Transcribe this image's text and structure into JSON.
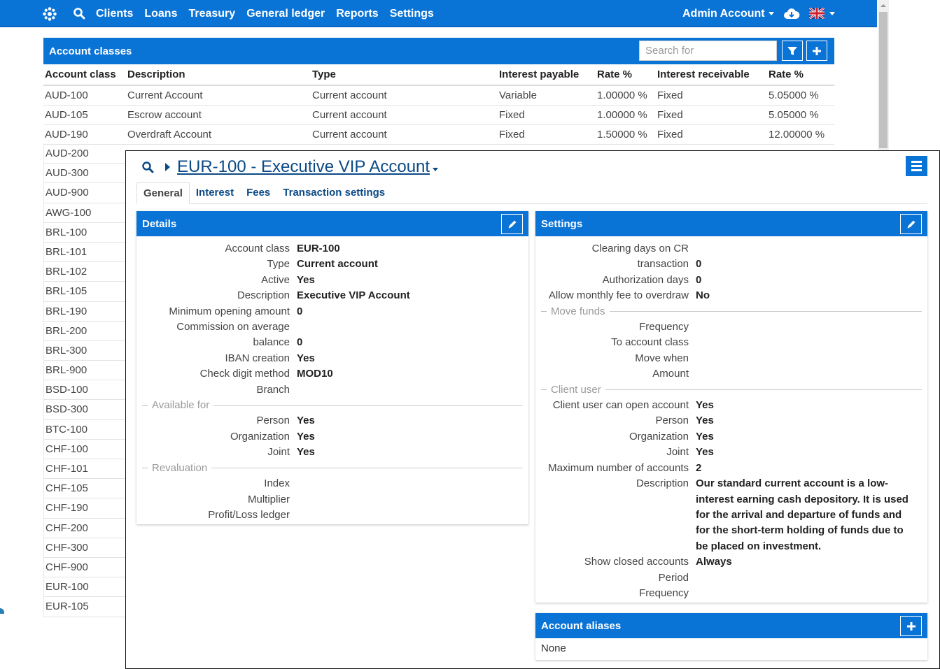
{
  "nav": {
    "items": [
      "Clients",
      "Loans",
      "Treasury",
      "General ledger",
      "Reports",
      "Settings"
    ],
    "user": "Admin Account",
    "icons": {
      "logo": "snowflake-logo-icon",
      "search": "search-icon",
      "cloud": "cloud-download-icon",
      "language": "uk-flag-icon"
    },
    "accent_color": "#0a73d6"
  },
  "list": {
    "title": "Account classes",
    "search_placeholder": "Search for",
    "columns": [
      "Account class",
      "Description",
      "Type",
      "Interest payable",
      "Rate %",
      "Interest receivable",
      "Rate %"
    ],
    "rows": [
      [
        "AUD-100",
        "Current Account",
        "Current account",
        "Variable",
        "1.00000 %",
        "Fixed",
        "5.05000 %"
      ],
      [
        "AUD-105",
        "Escrow account",
        "Current account",
        "Fixed",
        "1.00000 %",
        "Fixed",
        "5.05000 %"
      ],
      [
        "AUD-190",
        "Overdraft Account",
        "Current account",
        "Fixed",
        "1.50000 %",
        "Fixed",
        "12.00000 %"
      ]
    ],
    "more_classes": [
      "AUD-200",
      "AUD-300",
      "AUD-900",
      "AWG-100",
      "BRL-100",
      "BRL-101",
      "BRL-102",
      "BRL-105",
      "BRL-190",
      "BRL-200",
      "BRL-300",
      "BRL-900",
      "BSD-100",
      "BSD-300",
      "BTC-100",
      "CHF-100",
      "CHF-101",
      "CHF-105",
      "CHF-190",
      "CHF-200",
      "CHF-300",
      "CHF-900",
      "EUR-100",
      "EUR-105"
    ]
  },
  "detail": {
    "title": "EUR-100 - Executive VIP Account",
    "tabs": [
      "General",
      "Interest",
      "Fees",
      "Transaction settings"
    ],
    "active_tab": "General",
    "details": {
      "title": "Details",
      "fields": [
        {
          "label": "Account class",
          "value": "EUR-100"
        },
        {
          "label": "Type",
          "value": "Current account"
        },
        {
          "label": "Active",
          "value": "Yes"
        },
        {
          "label": "Description",
          "value": "Executive VIP Account"
        },
        {
          "label": "Minimum opening amount",
          "value": "0"
        },
        {
          "label": "Commission on average",
          "value": ""
        },
        {
          "label": "balance",
          "value": "0"
        },
        {
          "label": "IBAN creation",
          "value": "Yes"
        },
        {
          "label": "Check digit method",
          "value": "MOD10"
        },
        {
          "label": "Branch",
          "value": ""
        }
      ],
      "available_for": {
        "title": "Available for",
        "fields": [
          {
            "label": "Person",
            "value": "Yes"
          },
          {
            "label": "Organization",
            "value": "Yes"
          },
          {
            "label": "Joint",
            "value": "Yes"
          }
        ]
      },
      "revaluation": {
        "title": "Revaluation",
        "fields": [
          {
            "label": "Index",
            "value": ""
          },
          {
            "label": "Multiplier",
            "value": ""
          },
          {
            "label": "Profit/Loss ledger",
            "value": ""
          }
        ]
      }
    },
    "settings": {
      "title": "Settings",
      "fields": [
        {
          "label": "Clearing days on CR",
          "value": ""
        },
        {
          "label": "transaction",
          "value": "0"
        },
        {
          "label": "Authorization days",
          "value": "0"
        },
        {
          "label": "Allow monthly fee to overdraw",
          "value": "No"
        }
      ],
      "move_funds": {
        "title": "Move funds",
        "fields": [
          {
            "label": "Frequency",
            "value": ""
          },
          {
            "label": "To account class",
            "value": ""
          },
          {
            "label": "Move when",
            "value": ""
          },
          {
            "label": "Amount",
            "value": ""
          }
        ]
      },
      "client_user": {
        "title": "Client user",
        "fields": [
          {
            "label": "Client user can open account",
            "value": "Yes"
          },
          {
            "label": "Person",
            "value": "Yes"
          },
          {
            "label": "Organization",
            "value": "Yes"
          },
          {
            "label": "Joint",
            "value": "Yes"
          },
          {
            "label": "Maximum number of accounts",
            "value": "2"
          },
          {
            "label": "Description",
            "value": "Our standard current account is a low-interest earning cash depository. It is used for the arrival and departure of funds and for the short-term holding of funds due to be placed on investment."
          },
          {
            "label": "Show closed accounts",
            "value": "Always"
          },
          {
            "label": "Period",
            "value": ""
          },
          {
            "label": "Frequency",
            "value": ""
          }
        ]
      }
    },
    "aliases": {
      "title": "Account aliases",
      "value": "None"
    }
  }
}
